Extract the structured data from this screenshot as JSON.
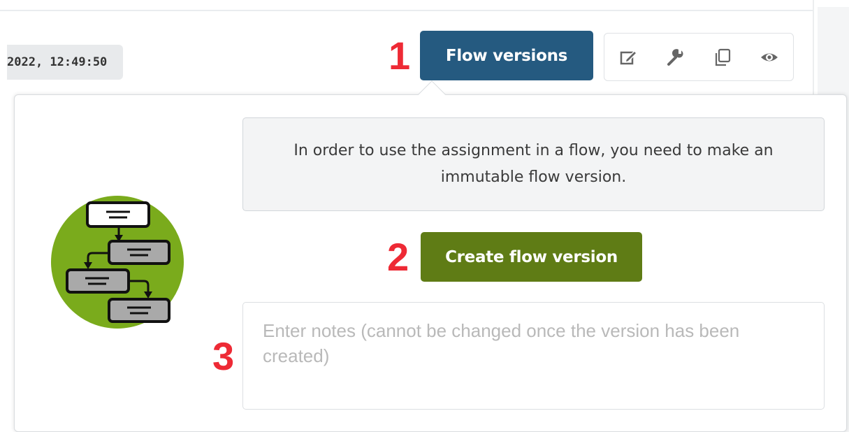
{
  "header": {
    "timestamp": "2022, 12:49:50",
    "flow_versions_label": "Flow versions",
    "toolbar": [
      {
        "icon": "edit-icon"
      },
      {
        "icon": "wrench-icon"
      },
      {
        "icon": "copy-icon"
      },
      {
        "icon": "eye-icon"
      }
    ]
  },
  "markers": {
    "one": "1",
    "two": "2",
    "three": "3"
  },
  "popover": {
    "info_text": "In order to use the assignment in a flow, you need to make an immutable flow version.",
    "create_label": "Create flow version",
    "notes_placeholder": "Enter notes (cannot be changed once the version has been created)",
    "notes_value": ""
  },
  "colors": {
    "flow_versions_bg": "#255a80",
    "create_bg": "#5f7c15",
    "marker": "#ee2a35",
    "illustration_circle": "#7aab1c"
  }
}
